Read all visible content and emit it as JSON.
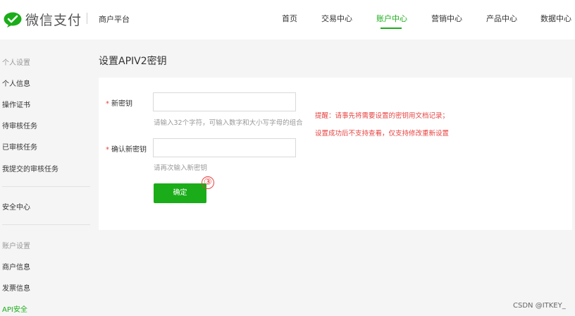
{
  "header": {
    "brand": "微信支付",
    "platform": "商户平台",
    "nav": [
      {
        "label": "首页"
      },
      {
        "label": "交易中心"
      },
      {
        "label": "账户中心"
      },
      {
        "label": "营销中心"
      },
      {
        "label": "产品中心"
      },
      {
        "label": "数据中心"
      }
    ],
    "active_nav": "账户中心"
  },
  "sidebar": {
    "group1_title": "个人设置",
    "group1_items": [
      "个人信息",
      "操作证书",
      "待审核任务",
      "已审核任务",
      "我提交的审核任务"
    ],
    "security_center": "安全中心",
    "group2_title": "账户设置",
    "group2_items": [
      "商户信息",
      "发票信息",
      "API安全"
    ],
    "active_item": "API安全"
  },
  "main": {
    "title": "设置APIV2密钥",
    "required_mark": "*",
    "new_key_label": "新密钥",
    "new_key_value": "",
    "new_key_hint": "请输入32个字符，可输入数字和大小写字母的组合",
    "confirm_label": "确认新密钥",
    "confirm_value": "",
    "confirm_hint": "请再次输入新密钥",
    "confirm_button": "确定",
    "step_marker": "③",
    "warning_line1": "提醒：请事先将需要设置的密钥用文档记录；",
    "warning_line2": "设置成功后不支持查看，仅支持修改重新设置"
  },
  "watermark": "CSDN @ITKEY_",
  "colors": {
    "accent": "#1aad19",
    "warning": "#e64340"
  }
}
